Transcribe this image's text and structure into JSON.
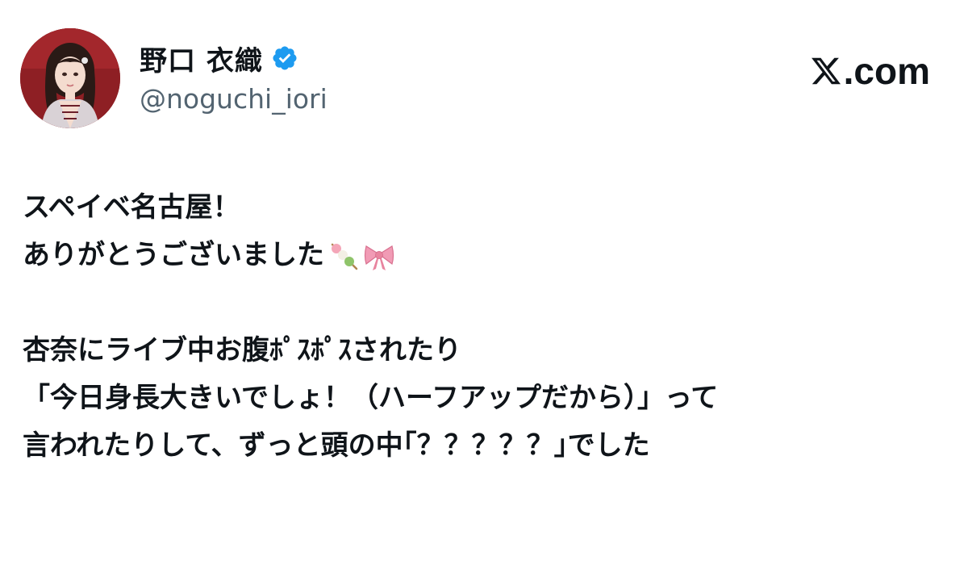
{
  "profile": {
    "display_name": "野口 衣織",
    "handle": "@noguchi_iori",
    "verified": true,
    "verified_color": "#1d9bf0"
  },
  "brand": {
    "label": ".com",
    "icon": "x-logo-icon"
  },
  "tweet": {
    "lines": [
      "スペイベ名古屋！",
      "ありがとうございました",
      "",
      "杏奈にライブ中お腹ﾎﾟｽﾎﾟｽされたり",
      "「今日身長大きいでしょ！（ハーフアップだから）」って",
      "言われたりして、ずっと頭の中｢？？？？？｣でした"
    ],
    "emojis": [
      "dango-icon",
      "ribbon-icon"
    ]
  },
  "colors": {
    "text": "#0f1419",
    "secondary": "#536471",
    "avatar_bg": "#8e1f24"
  }
}
